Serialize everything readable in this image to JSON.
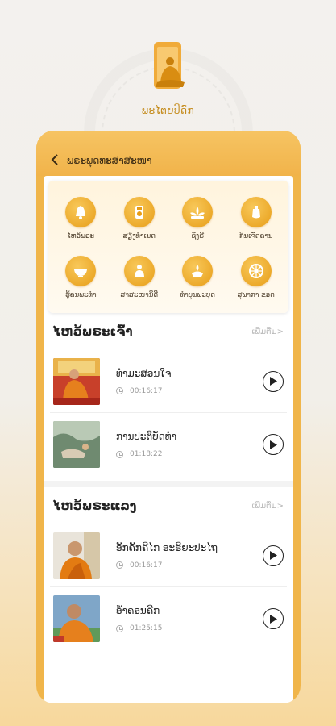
{
  "brand": {
    "name": "ພະໄຕຍປິດົກ",
    "logo_icon": "monk-phone-icon"
  },
  "header": {
    "title": "ພຣະພຸດທະສາສະໜາ",
    "back_icon": "chevron-left-icon"
  },
  "menu": [
    {
      "label": "ໄຫວ້ພຣະ",
      "icon": "bell-icon"
    },
    {
      "label": "ສຽງທຳເນດ",
      "icon": "radio-icon"
    },
    {
      "label": "ຊັງຣີ",
      "icon": "lotus-icon"
    },
    {
      "label": "ກິນເຈັດຄານ",
      "icon": "vase-icon"
    },
    {
      "label": "ຮູ້ຄນພະທຳ",
      "icon": "alms-bowl-icon"
    },
    {
      "label": "ສາສະໜານິດີ",
      "icon": "monk-icon"
    },
    {
      "label": "ທຳບຸນພະບຸດ",
      "icon": "offering-icon"
    },
    {
      "label": "ສຸພາກາ ຂອດ",
      "icon": "dharma-wheel-icon"
    }
  ],
  "sections": [
    {
      "title": "ໄຫວ້ພຣະເຈົ້າ",
      "more": "ເພີ່ມຕື່ມ>",
      "items": [
        {
          "title": "ທຳມະສອນໃຈ",
          "time": "00:16:17"
        },
        {
          "title": "ການປະຕິບັດທຳ",
          "time": "01:18:22"
        }
      ]
    },
    {
      "title": "ໄຫວ້ພຣະແລງ",
      "more": "ເພີ່ມຕື່ມ>",
      "items": [
        {
          "title": "ອັກຄັກຄີໄກ ອະຣິຍະປະໄຖ",
          "time": "00:16:17"
        },
        {
          "title": "ອ້ຳຄອນຄີກ",
          "time": "01:25:15"
        }
      ]
    }
  ],
  "colors": {
    "accent": "#f0b54a",
    "icon_gold": "#e79d17"
  }
}
